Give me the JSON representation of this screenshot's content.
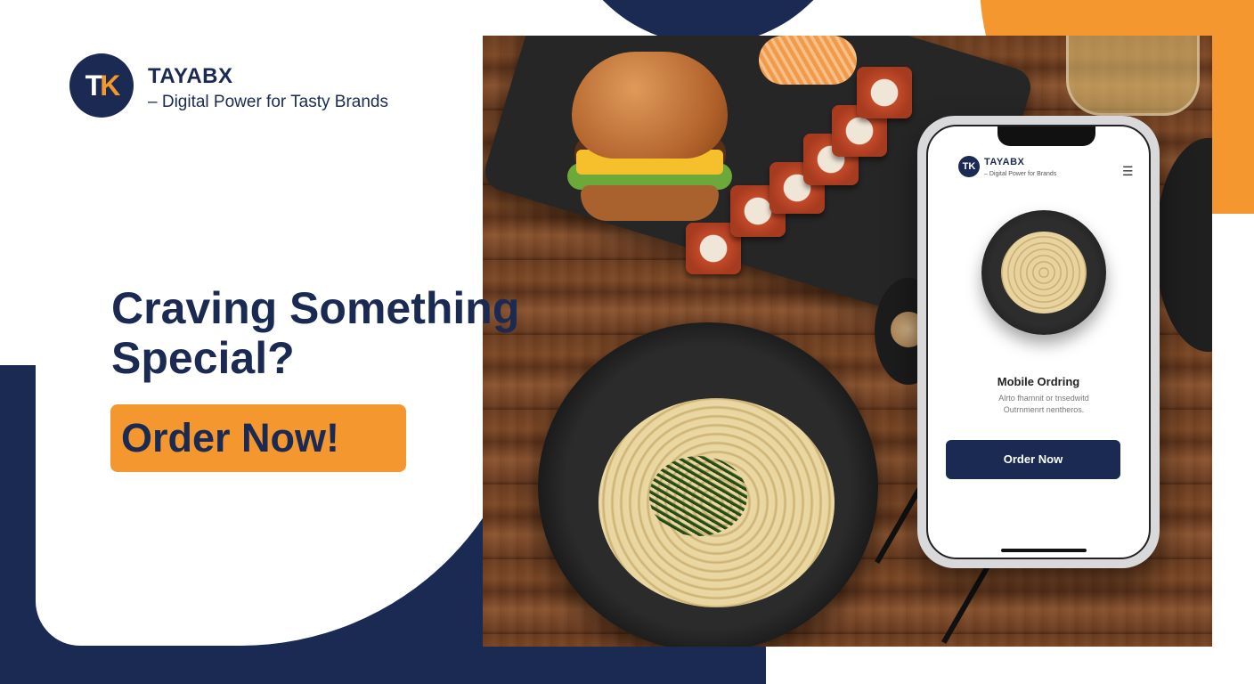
{
  "brand": {
    "logo_text_t": "T",
    "logo_text_k": "K",
    "name": "TAYABX",
    "tagline": "– Digital Power for Tasty Brands"
  },
  "hero": {
    "headline_line1": "Craving Something",
    "headline_line2": "Special?",
    "cta_label": "Order Now!"
  },
  "phone": {
    "logo_text": "TK",
    "brand": "TAYABX",
    "tagline": "– Digital Power for Brands",
    "menu_icon": "☰",
    "title": "Mobile Ordring",
    "desc_line1": "Alrto fhamnit or tnsedwitd",
    "desc_line2": "Outrnmenrt nentheros.",
    "button_label": "Order Now"
  },
  "colors": {
    "navy": "#1b2a52",
    "orange": "#f4972e",
    "white": "#ffffff"
  },
  "icons": [
    "menu-icon",
    "logo-mark"
  ]
}
